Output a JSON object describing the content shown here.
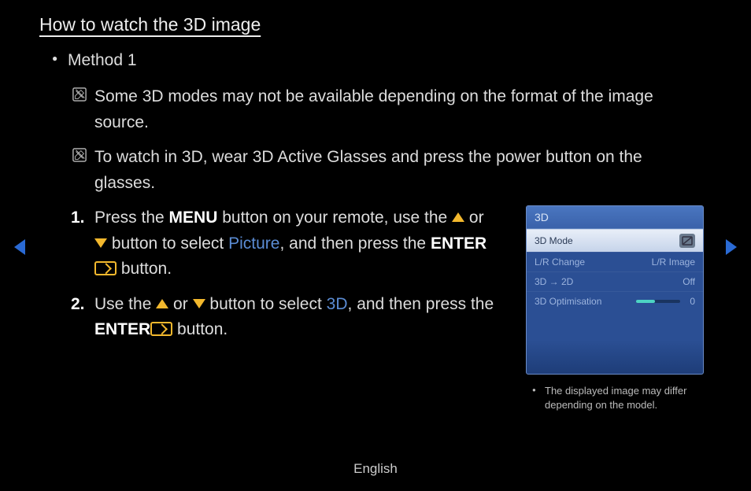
{
  "title": "How to watch the 3D image",
  "method_label": "Method 1",
  "notes": [
    "Some 3D modes may not be available depending on the format of the image source.",
    "To watch in 3D, wear 3D Active Glasses and press the power button on the glasses."
  ],
  "step1": {
    "num": "1.",
    "t1": "Press the ",
    "menu": "MENU",
    "t2": " button on your remote, use the ",
    "t3": " or ",
    "t4": " button to select ",
    "picture": "Picture",
    "t5": ", and then press the ",
    "enter": "ENTER",
    "t6": " button."
  },
  "step2": {
    "num": "2.",
    "t1": "Use the ",
    "t2": " or ",
    "t3": " button to select ",
    "threed": "3D",
    "t4": ", and then press the ",
    "enter": "ENTER",
    "t5": " button."
  },
  "panel": {
    "title": "3D",
    "rows": {
      "mode": {
        "label": "3D Mode"
      },
      "lr": {
        "label": "L/R Change",
        "value": "L/R Image"
      },
      "to2d": {
        "label": "3D → 2D",
        "value": "Off"
      },
      "opt": {
        "label": "3D Optimisation",
        "value": "0"
      }
    },
    "caption": "The displayed image may differ depending on the model."
  },
  "footer": "English"
}
